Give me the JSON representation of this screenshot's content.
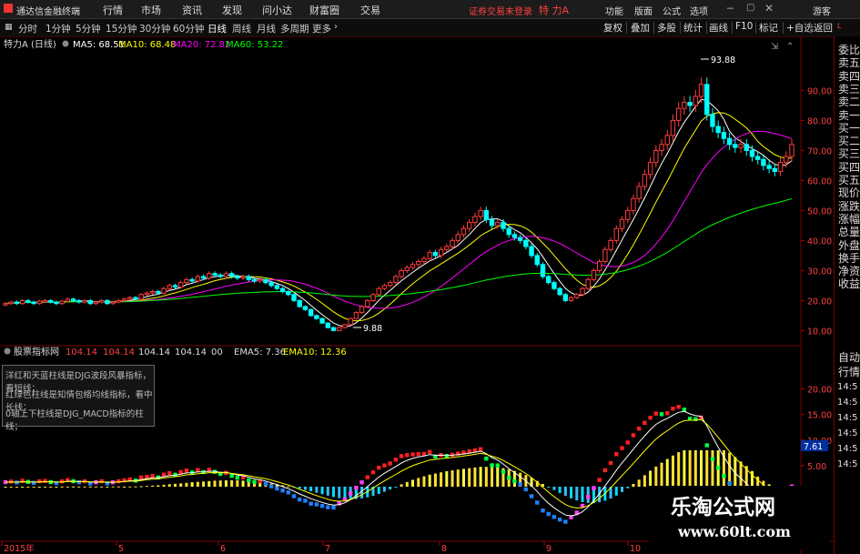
{
  "app": {
    "title": "通达信金融终端",
    "status": "证券交易未登录",
    "stock": "特 力A",
    "guest": "游客"
  },
  "menu": [
    "行情",
    "市场",
    "资讯",
    "发现",
    "问小达",
    "财富圈",
    "交易"
  ],
  "menu_right": [
    "功能",
    "版面",
    "公式",
    "选项"
  ],
  "periods": [
    "分时",
    "1分钟",
    "5分钟",
    "15分钟",
    "30分钟",
    "60分钟",
    "日线",
    "周线",
    "月线",
    "多周期",
    "更多"
  ],
  "period_active": "日线",
  "tools": [
    "复权",
    "叠加",
    "多股",
    "统计",
    "画线",
    "F10",
    "标记",
    "+自选",
    "返回"
  ],
  "main_header": {
    "stock": "特力A (日线)",
    "ma5": "MA5: 68.51",
    "ma10": "MA10: 68.48",
    "ma20": "MA20: 72.82",
    "ma60": "MA60: 53.22"
  },
  "price_axis": [
    "90.00",
    "80.00",
    "70.00",
    "60.00",
    "50.00",
    "40.00",
    "30.00",
    "20.00",
    "10.00"
  ],
  "annotations": {
    "high": "93.88",
    "low": "9.88"
  },
  "indicator_header": {
    "name": "股票指标网",
    "v1": "104.14",
    "v2": "104.14",
    "v3": "104.14",
    "v4": "104.14",
    "v5": "00",
    "ema5": "EMA5: 7.36",
    "ema10": "EMA10: 12.36"
  },
  "indicator_legend": [
    "洋红和天蓝柱线是DJG波段风暴指标，看短线；",
    "红绿色柱线是知情包络均线指标，看中长线；",
    "0轴上下柱线是DJG_MACD指标的柱线；"
  ],
  "indicator_axis": [
    "20.00",
    "15.00",
    "10.00",
    "5.00"
  ],
  "indicator_current": "7.61",
  "date_axis": [
    "2015年",
    "5",
    "6",
    "7",
    "8",
    "9",
    "10"
  ],
  "sidebar": [
    "委比",
    "卖五",
    "卖四",
    "卖三",
    "卖二",
    "卖一",
    "买一",
    "买二",
    "买三",
    "买四",
    "买五",
    "现价",
    "涨跌",
    "涨幅",
    "总量",
    "外盘",
    "换手",
    "净资",
    "收益"
  ],
  "sidebar_bottom": [
    "自动",
    "行情"
  ],
  "sidebar_times": [
    "14:5",
    "14:5",
    "14:5",
    "14:5",
    "14:5",
    "14:5"
  ],
  "watermark": {
    "title": "乐淘公式网",
    "url": "www.60lt.com"
  },
  "colors": {
    "up": "#ff3c3c",
    "down": "#00ffff",
    "ma5": "#ffffff",
    "ma10": "#ffff00",
    "ma20": "#ff00ff",
    "ma60": "#00ff00",
    "accent": "#ff2020"
  },
  "chart_data": {
    "type": "candlestick",
    "price_range": [
      8,
      98
    ],
    "closes": [
      19,
      19.5,
      19,
      20,
      19.5,
      19,
      19.8,
      20,
      19.5,
      19,
      19.8,
      20.5,
      20,
      19.5,
      20,
      19,
      19.5,
      20,
      19,
      19.5,
      20,
      20.5,
      21,
      20.5,
      22,
      22.5,
      23,
      22.5,
      24,
      25,
      24.5,
      26,
      27,
      26.5,
      28,
      27.5,
      29,
      28.5,
      28,
      29,
      28,
      27.5,
      28,
      27,
      26.5,
      27,
      26,
      25,
      24,
      23,
      22,
      20,
      18,
      17,
      15,
      14,
      12.5,
      11,
      10,
      11,
      12,
      14,
      16,
      18,
      20,
      22,
      24,
      25,
      26,
      28,
      30,
      31,
      32,
      33,
      34,
      36,
      35,
      37,
      38,
      40,
      42,
      44,
      46,
      48,
      50,
      47,
      45,
      46,
      44,
      42,
      41,
      40,
      38,
      35,
      32,
      28,
      26,
      24,
      22,
      20,
      21,
      22,
      24,
      27,
      30,
      33,
      37,
      40,
      44,
      47,
      50,
      54,
      58,
      62,
      66,
      70,
      72,
      75,
      80,
      84,
      86,
      85,
      88,
      92,
      82,
      78,
      76,
      74,
      72,
      71,
      72,
      70,
      68,
      67,
      65,
      64,
      63,
      66,
      68,
      72
    ]
  }
}
